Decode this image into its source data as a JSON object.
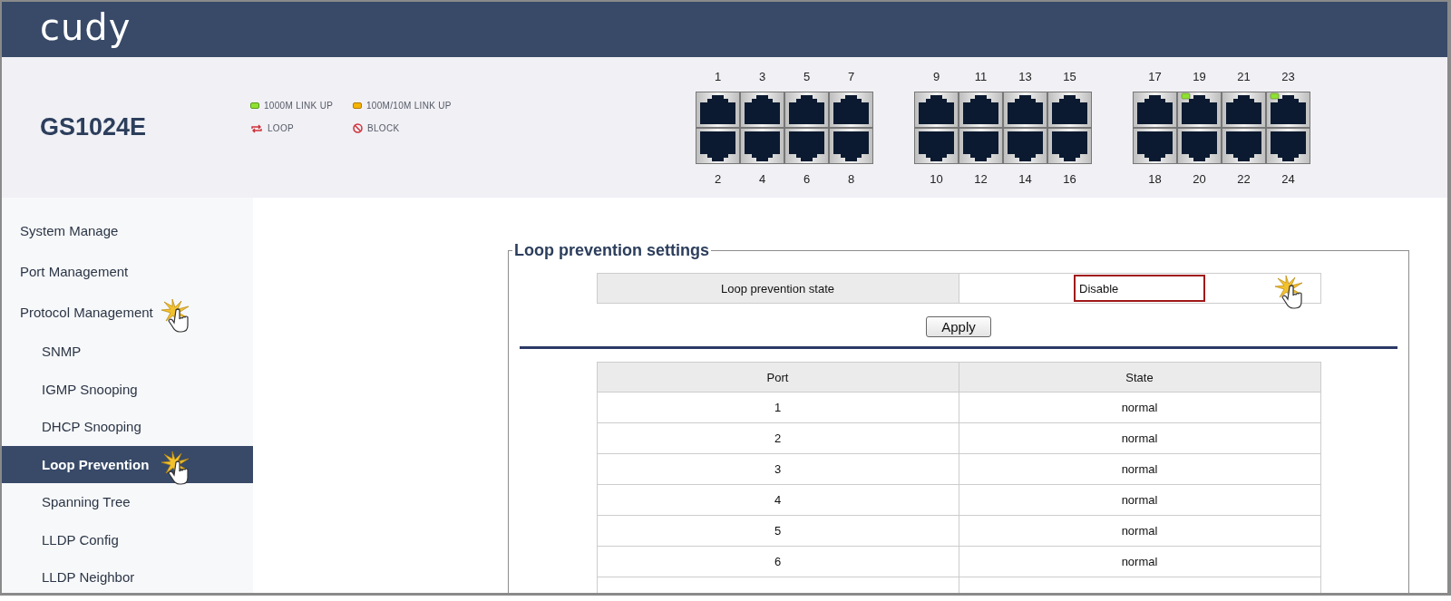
{
  "header": {
    "logo": "cudy"
  },
  "device": {
    "model": "GS1024E"
  },
  "legend": [
    {
      "kind": "link1000",
      "label": "1000M LINK UP"
    },
    {
      "kind": "link100",
      "label": "100M/10M LINK UP"
    },
    {
      "kind": "loop",
      "label": "LOOP"
    },
    {
      "kind": "block",
      "label": "BLOCK"
    }
  ],
  "ports": [
    {
      "number": "1",
      "link_up": false
    },
    {
      "number": "2",
      "link_up": false
    },
    {
      "number": "3",
      "link_up": false
    },
    {
      "number": "4",
      "link_up": false
    },
    {
      "number": "5",
      "link_up": false
    },
    {
      "number": "6",
      "link_up": false
    },
    {
      "number": "7",
      "link_up": false
    },
    {
      "number": "8",
      "link_up": false
    },
    {
      "number": "9",
      "link_up": false
    },
    {
      "number": "10",
      "link_up": false
    },
    {
      "number": "11",
      "link_up": false
    },
    {
      "number": "12",
      "link_up": false
    },
    {
      "number": "13",
      "link_up": false
    },
    {
      "number": "14",
      "link_up": false
    },
    {
      "number": "15",
      "link_up": false
    },
    {
      "number": "16",
      "link_up": false
    },
    {
      "number": "17",
      "link_up": false
    },
    {
      "number": "18",
      "link_up": false
    },
    {
      "number": "19",
      "link_up": true
    },
    {
      "number": "20",
      "link_up": false
    },
    {
      "number": "21",
      "link_up": false
    },
    {
      "number": "22",
      "link_up": false
    },
    {
      "number": "23",
      "link_up": true
    },
    {
      "number": "24",
      "link_up": false
    }
  ],
  "sidebar": {
    "items": [
      {
        "label": "System Manage",
        "selected": false
      },
      {
        "label": "Port Management",
        "selected": false
      },
      {
        "label": "Protocol Management",
        "selected": false,
        "expanded": true,
        "children": [
          {
            "label": "SNMP",
            "selected": false
          },
          {
            "label": "IGMP Snooping",
            "selected": false
          },
          {
            "label": "DHCP Snooping",
            "selected": false
          },
          {
            "label": "Loop Prevention",
            "selected": true
          },
          {
            "label": "Spanning Tree",
            "selected": false
          },
          {
            "label": "LLDP Config",
            "selected": false
          },
          {
            "label": "LLDP Neighbor",
            "selected": false
          }
        ]
      }
    ]
  },
  "settings": {
    "title": "Loop prevention settings",
    "field_label": "Loop prevention state",
    "value": "Disable",
    "apply_button": "Apply"
  },
  "table": {
    "columns": [
      "Port",
      "State"
    ],
    "rows": [
      [
        "1",
        "normal"
      ],
      [
        "2",
        "normal"
      ],
      [
        "3",
        "normal"
      ],
      [
        "4",
        "normal"
      ],
      [
        "5",
        "normal"
      ],
      [
        "6",
        "normal"
      ],
      [
        "",
        ""
      ]
    ]
  }
}
